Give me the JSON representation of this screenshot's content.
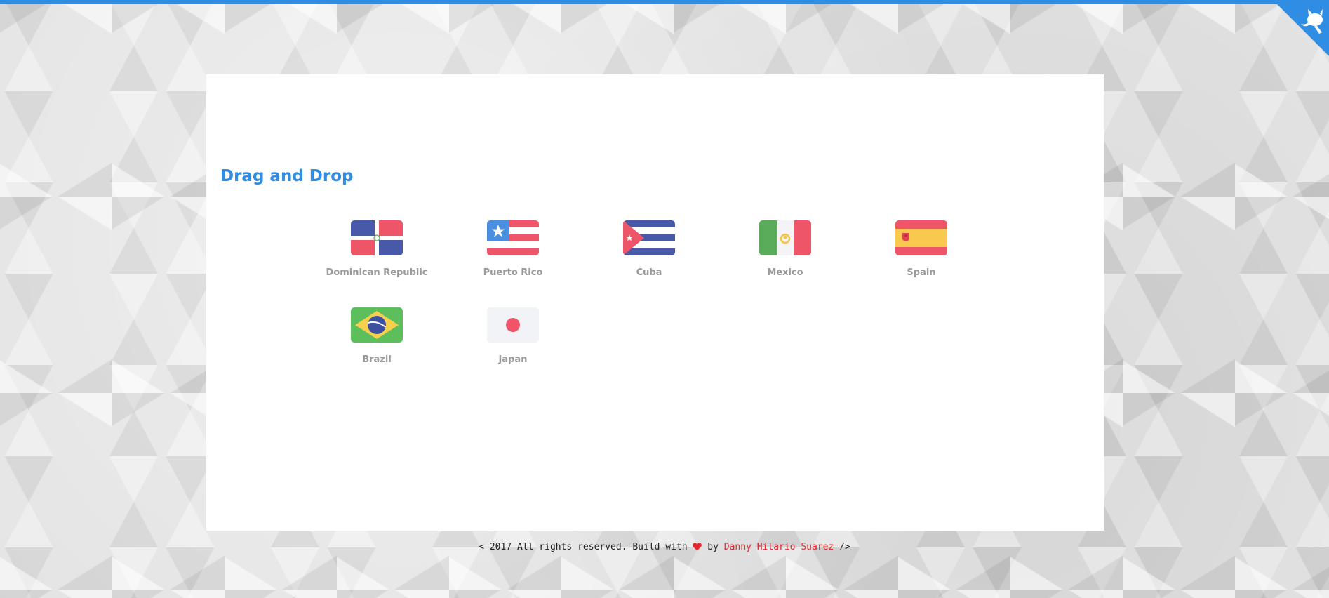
{
  "header": {
    "github_corner_icon": "github-octocat-icon",
    "accent_color": "#2f8de4"
  },
  "main": {
    "title": "Drag and Drop",
    "countries": [
      {
        "name": "Dominican Republic",
        "flag": "dominican-republic-flag-icon"
      },
      {
        "name": "Puerto Rico",
        "flag": "puerto-rico-flag-icon"
      },
      {
        "name": "Cuba",
        "flag": "cuba-flag-icon"
      },
      {
        "name": "Mexico",
        "flag": "mexico-flag-icon"
      },
      {
        "name": "Spain",
        "flag": "spain-flag-icon"
      },
      {
        "name": "Brazil",
        "flag": "brazil-flag-icon"
      },
      {
        "name": "Japan",
        "flag": "japan-flag-icon"
      }
    ]
  },
  "footer": {
    "prefix": "< 2017 All rights reserved. Build with",
    "heart_icon": "heart-icon",
    "by": "by",
    "author": "Danny Hilario Suarez",
    "suffix": "/>",
    "author_color": "#e4262d"
  }
}
